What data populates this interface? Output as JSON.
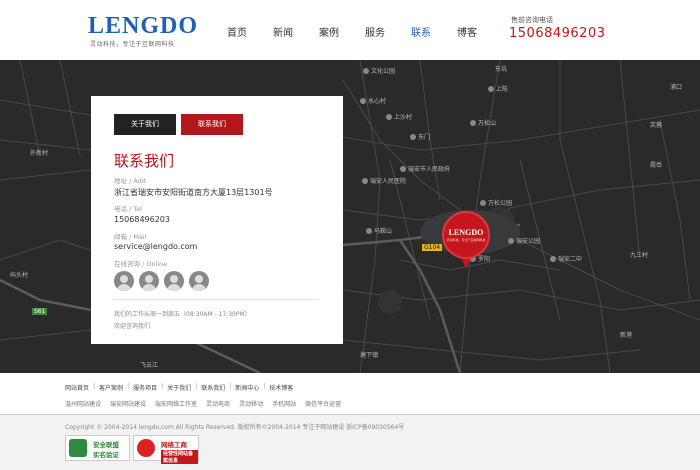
{
  "header": {
    "logo_text": "LENGDO",
    "logo_sub": "灵动科技，专注于互联网科技",
    "nav": [
      "首页",
      "新闻",
      "案例",
      "服务",
      "联系",
      "博客"
    ],
    "phone_label": "售前咨询电话",
    "phone": "15068496203"
  },
  "panel": {
    "btn_about": "关于我们",
    "btn_contact": "联系我们",
    "title": "联系我们",
    "address_label": "地址 / Add",
    "address_value": "浙江省瑞安市安阳街道南方大厦13层1301号",
    "tel_label": "电话 / Tel",
    "tel_value": "15068496203",
    "mail_label": "邮箱 / Mail",
    "mail_value": "service@lengdo.com",
    "online_label": "在线咨询 / Online",
    "hours": "我们的工作从周一到周五（08:30AM - 17:30PM）",
    "welcome": "欢迎咨询我们"
  },
  "map": {
    "pin_title": "LENGDO",
    "pin_sub": "灵动科技，专注于互联网科技",
    "labels": [
      "文化公园",
      "东坑",
      "上陈",
      "外新村",
      "水心村",
      "上沙村",
      "万松山",
      "东门",
      "瑞安人民医院",
      "瑞安市人民政府",
      "万松公园",
      "芙蓉",
      "瑞安公园",
      "瑞安二中",
      "马鞍山",
      "飞云江",
      "屿头村",
      "塘下镇",
      "浦口",
      "霞岙",
      "九三村",
      "罗阳",
      "新港"
    ],
    "road_signs": [
      "G104",
      "S61",
      "G104"
    ]
  },
  "footer": {
    "links_row1": [
      "网站首页",
      "客户案例",
      "服务项目",
      "关于我们",
      "联系我们",
      "新闻中心",
      "技术博客"
    ],
    "links_row2": [
      "温州网站建设",
      "瑞安网站建设",
      "瑞安网络工作室",
      "灵动电商",
      "灵动移动",
      "手机网站",
      "微信平台运营"
    ],
    "copyright": "Copyright © 2004-2014 lengdo.com All Rights Reserved.  版权所有©2004-2014 专注于网站建设  浙ICP备09030564号",
    "badge1_line1": "安全联盟",
    "badge1_line2": "实名验证",
    "badge2_line1": "网络工商",
    "badge2_line2": "经营性网站备案信息"
  }
}
